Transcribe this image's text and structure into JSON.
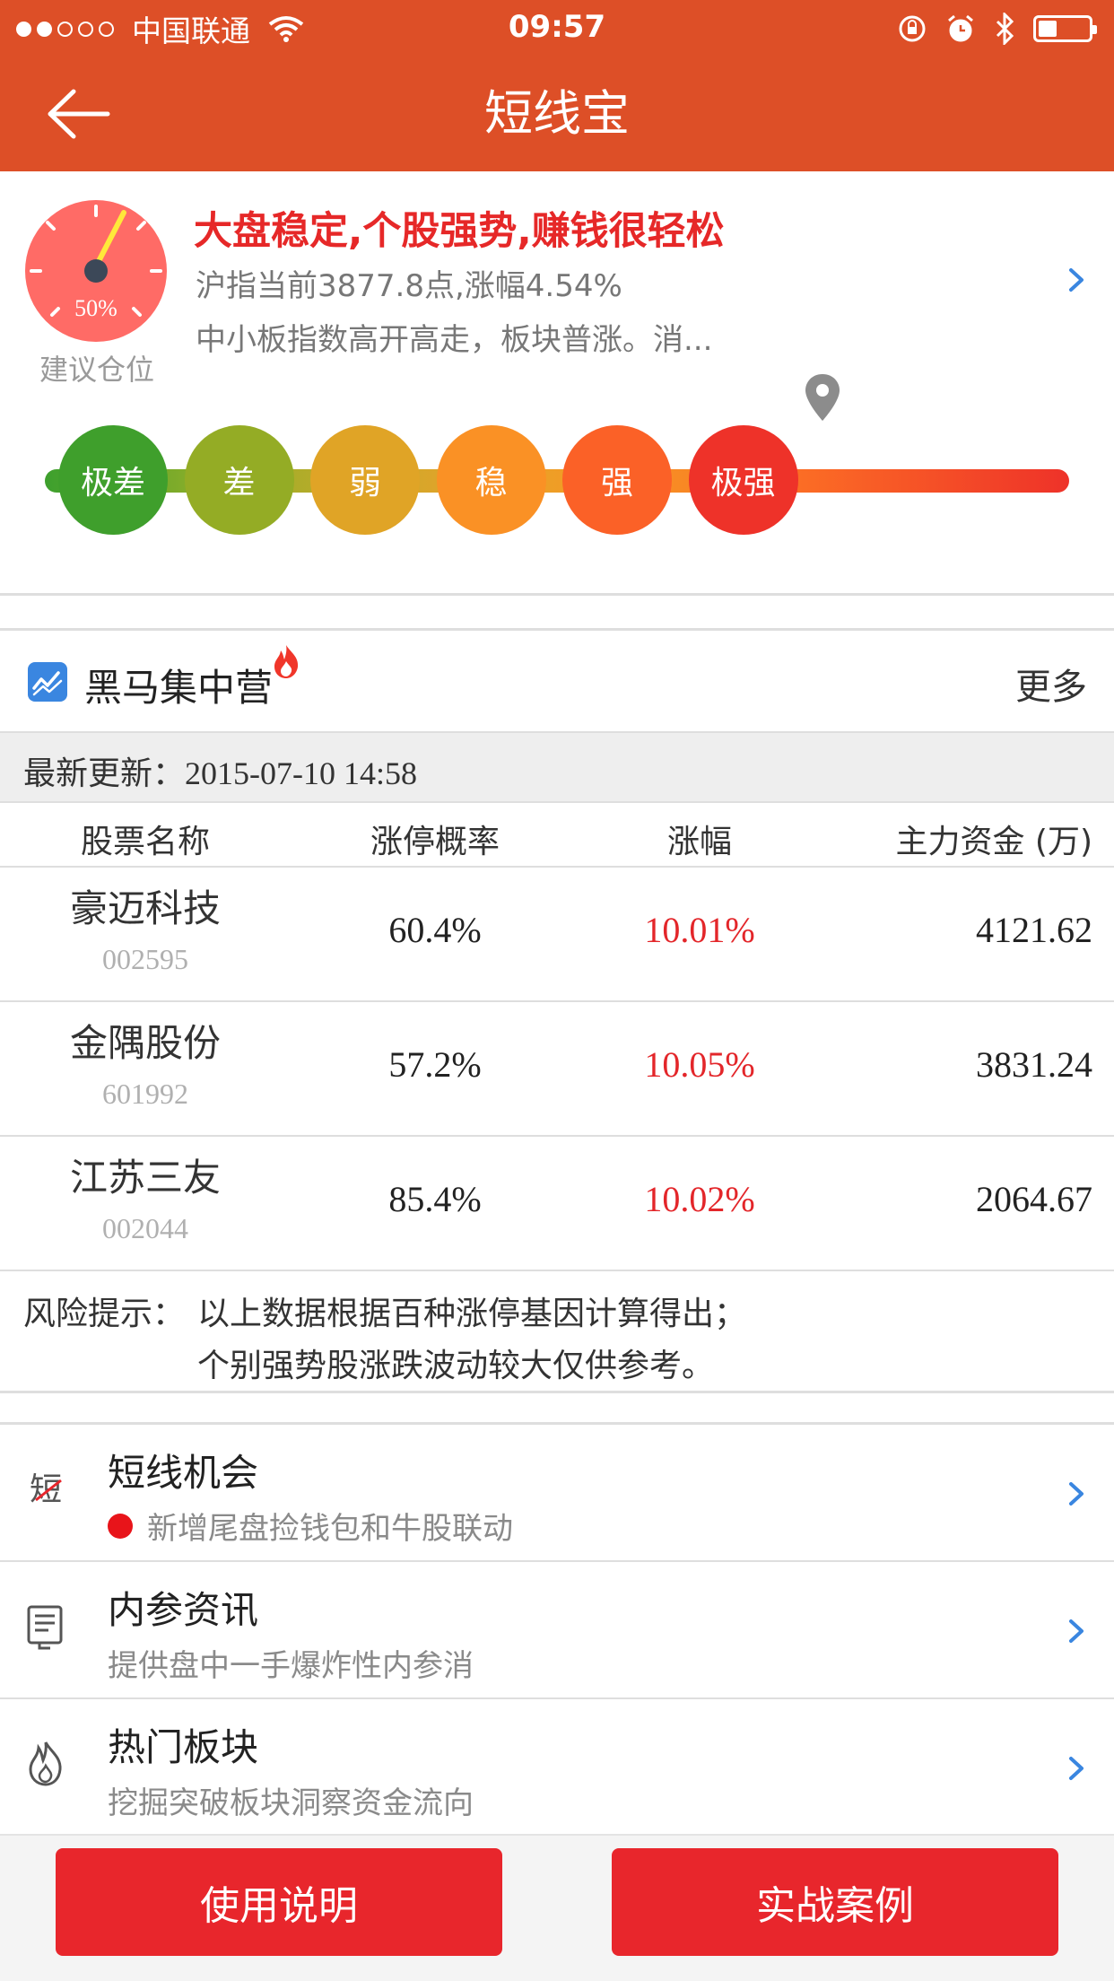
{
  "status_bar": {
    "carrier": "中国联通",
    "time": "09:57"
  },
  "nav": {
    "title": "短线宝"
  },
  "market": {
    "position_percent": "50%",
    "position_caption": "建议仓位",
    "headline": "大盘稳定,个股强势,赚钱很轻松",
    "index_line": "沪指当前3877.8点,涨幅4.54%",
    "summary": "中小板指数高开高走，板块普涨。消...",
    "scale_levels": [
      "极差",
      "差",
      "弱",
      "稳",
      "强",
      "极强"
    ],
    "scale_colors": [
      "#3f9f2c",
      "#94ac25",
      "#e0a426",
      "#fa9125",
      "#fb6127",
      "#ee3229"
    ],
    "current_level": "强"
  },
  "dark_horse": {
    "title": "黑马集中营",
    "more": "更多",
    "update_label": "最新更新：",
    "update_time": "2015-07-10 14:58",
    "columns": [
      "股票名称",
      "涨停概率",
      "涨幅",
      "主力资金 (万)"
    ],
    "rows": [
      {
        "name": "豪迈科技",
        "code": "002595",
        "probability": "60.4%",
        "rise": "10.01%",
        "fund": "4121.62"
      },
      {
        "name": "金隅股份",
        "code": "601992",
        "probability": "57.2%",
        "rise": "10.05%",
        "fund": "3831.24"
      },
      {
        "name": "江苏三友",
        "code": "002044",
        "probability": "85.4%",
        "rise": "10.02%",
        "fund": "2064.67"
      }
    ],
    "risk_label": "风险提示：",
    "risk_line1": "以上数据根据百种涨停基因计算得出；",
    "risk_line2": "个别强势股涨跌波动较大仅供参考。"
  },
  "features": [
    {
      "icon": "short-line-icon",
      "title": "短线机会",
      "subtitle": "新增尾盘捡钱包和牛股联动",
      "has_dot": true
    },
    {
      "icon": "news-doc-icon",
      "title": "内参资讯",
      "subtitle": "提供盘中一手爆炸性内参消",
      "has_dot": false
    },
    {
      "icon": "flame-icon",
      "title": "热门板块",
      "subtitle": "挖掘突破板块洞察资金流向",
      "has_dot": false
    }
  ],
  "buttons": {
    "guide": "使用说明",
    "cases": "实战案例"
  },
  "colors": {
    "brand": "#dd4f27",
    "accent_red": "#e3262a",
    "link_blue": "#3a86e0"
  }
}
